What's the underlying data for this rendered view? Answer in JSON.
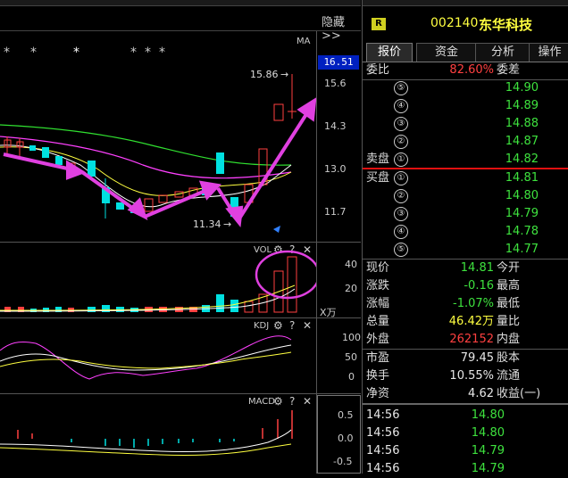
{
  "header": {
    "hide_label": "隐藏>>",
    "badge": "R",
    "stock_code": "002140",
    "stock_name": "东华科技"
  },
  "tabs": [
    "报价",
    "资金",
    "分析",
    "操作"
  ],
  "main_chart": {
    "ma_label": "MA",
    "current_price_tag": "16.51",
    "high_label": "15.86",
    "low_label": "11.34",
    "y_ticks": [
      "15.6",
      "14.3",
      "13.0",
      "11.7"
    ],
    "star_marks": [
      "*",
      "*",
      "*",
      "*",
      "*",
      "*"
    ]
  },
  "vol_chart": {
    "title": "VOL",
    "y_ticks": [
      "40",
      "20"
    ],
    "unit": "X万"
  },
  "kdj_chart": {
    "title": "KDJ",
    "y_ticks": [
      "100",
      "50",
      "0"
    ]
  },
  "macd_chart": {
    "title": "MACD",
    "y_ticks": [
      "0.5",
      "0.0",
      "-0.5"
    ]
  },
  "panel_icons": [
    "gear-icon",
    "question-icon",
    "close-icon"
  ],
  "panel_icon_glyphs": {
    "gear": "⚙",
    "question": "?",
    "close": "✕"
  },
  "order_book": {
    "weibi_label": "委比",
    "weibi_value": "82.60%",
    "weicha_label": "委差",
    "sell_label": "卖盘",
    "buy_label": "买盘",
    "sell": [
      {
        "level": "⑤",
        "price": "14.90"
      },
      {
        "level": "④",
        "price": "14.89"
      },
      {
        "level": "③",
        "price": "14.88"
      },
      {
        "level": "②",
        "price": "14.87"
      },
      {
        "level": "①",
        "price": "14.82"
      }
    ],
    "buy": [
      {
        "level": "①",
        "price": "14.81"
      },
      {
        "level": "②",
        "price": "14.80"
      },
      {
        "level": "③",
        "price": "14.79"
      },
      {
        "level": "④",
        "price": "14.78"
      },
      {
        "level": "⑤",
        "price": "14.77"
      }
    ]
  },
  "quote": [
    {
      "label": "现价",
      "value": "14.81",
      "label2": "今开",
      "color": "green"
    },
    {
      "label": "涨跌",
      "value": "-0.16",
      "label2": "最高",
      "color": "green"
    },
    {
      "label": "涨幅",
      "value": "-1.07%",
      "label2": "最低",
      "color": "green"
    },
    {
      "label": "总量",
      "value": "46.42万",
      "label2": "量比",
      "color": "yellow"
    },
    {
      "label": "外盘",
      "value": "262152",
      "label2": "内盘",
      "color": "red"
    }
  ],
  "fundamentals": [
    {
      "label": "市盈",
      "value": "79.45",
      "label2": "股本"
    },
    {
      "label": "换手",
      "value": "10.55%",
      "label2": "流通"
    },
    {
      "label": "净资",
      "value": "4.62",
      "label2": "收益(一)"
    }
  ],
  "ticks": [
    {
      "time": "14:56",
      "price": "14.80"
    },
    {
      "time": "14:56",
      "price": "14.80"
    },
    {
      "time": "14:56",
      "price": "14.79"
    },
    {
      "time": "14:56",
      "price": "14.79"
    }
  ],
  "colors": {
    "up": "#ff4040",
    "down": "#00e0e0",
    "green": "#3ee23e",
    "yellow": "#ffff40",
    "magenta": "#ff40ff",
    "annotation": "#e040e0"
  }
}
